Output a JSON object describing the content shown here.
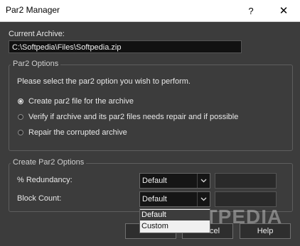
{
  "window": {
    "title": "Par2 Manager",
    "help_glyph": "?",
    "close_glyph": "✕"
  },
  "archive": {
    "label": "Current Archive:",
    "path": "C:\\Softpedia\\Files\\Softpedia.zip"
  },
  "par2_options": {
    "title": "Par2 Options",
    "prompt": "Please select the par2 option you wish to perform.",
    "options": [
      {
        "label": "Create par2 file for the archive",
        "checked": true
      },
      {
        "label": "Verify if archive and its par2 files needs repair and if possible",
        "checked": false
      },
      {
        "label": "Repair the corrupted archive",
        "checked": false
      }
    ]
  },
  "create_options": {
    "title": "Create Par2 Options",
    "redundancy_label": "% Redundancy:",
    "redundancy_value": "Default",
    "block_count_label": "Block Count:",
    "block_count_value": "Default",
    "dropdown_options": [
      "Default",
      "Custom"
    ],
    "dropdown_selected": "Default"
  },
  "buttons": {
    "ok": "OK",
    "cancel": "Cancel",
    "help": "Help"
  },
  "watermark": "SOFTPEDIA",
  "icons": {
    "dropdown_arrow": "chevron-down-icon"
  }
}
